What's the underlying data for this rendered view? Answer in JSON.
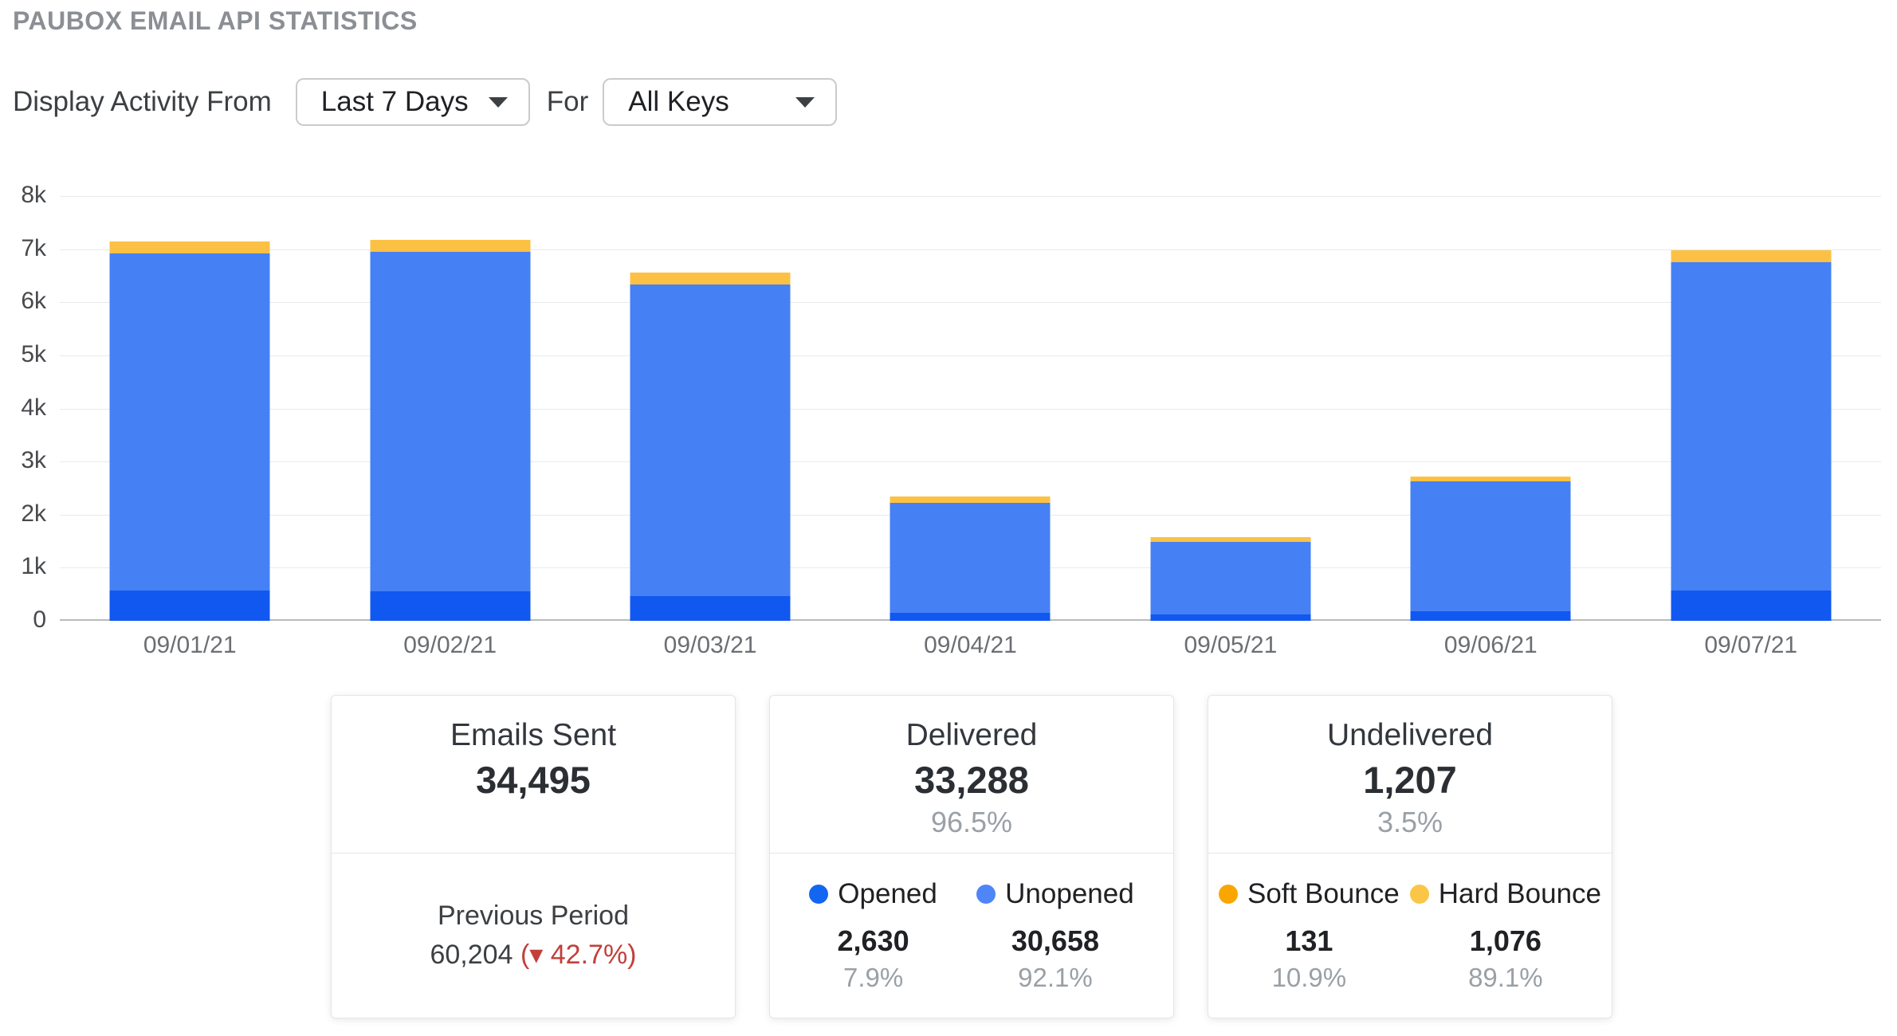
{
  "page": {
    "title": "PAUBOX EMAIL API STATISTICS"
  },
  "controls": {
    "label_from": "Display Activity From",
    "period_dropdown": {
      "value": "Last 7 Days"
    },
    "label_for": "For",
    "keys_dropdown": {
      "value": "All Keys"
    }
  },
  "chart_data": {
    "type": "bar",
    "subtype": "stacked",
    "categories": [
      "09/01/21",
      "09/02/21",
      "09/03/21",
      "09/04/21",
      "09/05/21",
      "09/06/21",
      "09/07/21"
    ],
    "series": [
      {
        "name": "Opened",
        "color": "#1158f1",
        "values": [
          570,
          560,
          470,
          155,
          120,
          180,
          575
        ]
      },
      {
        "name": "Unopened",
        "color": "#4680f5",
        "values": [
          6343,
          6388,
          5858,
          2072,
          1373,
          2448,
          6176
        ]
      },
      {
        "name": "Bounces",
        "color": "#fcc144",
        "values": [
          237,
          225,
          225,
          115,
          85,
          85,
          235
        ]
      }
    ],
    "bar_totals": [
      7150,
      7173,
      6553,
      2342,
      1578,
      2713,
      6986
    ],
    "title": "",
    "xlabel": "",
    "ylabel": "",
    "ylim": [
      0,
      8000
    ],
    "ytick_labels": [
      "0",
      "1k",
      "2k",
      "3k",
      "4k",
      "5k",
      "6k",
      "7k",
      "8k"
    ],
    "grid": true,
    "legend_position": "none"
  },
  "cards": [
    {
      "title": "Emails Sent",
      "value": "34,495",
      "footer": {
        "label": "Previous Period",
        "value": "60,204",
        "change": "(▾ 42.7%)",
        "change_color": "#c2403b"
      }
    },
    {
      "title": "Delivered",
      "value": "33,288",
      "percent": "96.5%",
      "legend": [
        {
          "label": "Opened",
          "color": "#1266f1",
          "value": "2,630",
          "percent": "7.9%"
        },
        {
          "label": "Unopened",
          "color": "#4e86f7",
          "value": "30,658",
          "percent": "92.1%"
        }
      ]
    },
    {
      "title": "Undelivered",
      "value": "1,207",
      "percent": "3.5%",
      "legend": [
        {
          "label": "Soft Bounce",
          "color": "#f9a602",
          "value": "131",
          "percent": "10.9%"
        },
        {
          "label": "Hard Bounce",
          "color": "#fbc647",
          "value": "1,076",
          "percent": "89.1%"
        }
      ]
    }
  ]
}
